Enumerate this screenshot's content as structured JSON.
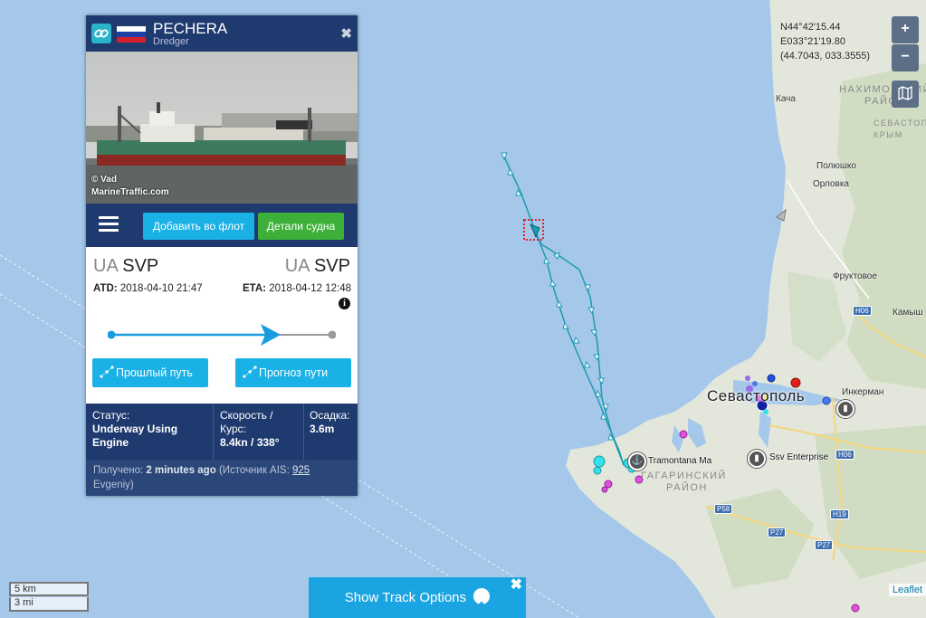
{
  "vessel": {
    "name": "PECHERA",
    "type": "Dredger",
    "photo_credit": "© Vad",
    "photo_site": "MarineTraffic.com",
    "buttons": {
      "add_fleet": "Добавить во флот",
      "details": "Детали судна"
    },
    "departure": {
      "country": "UA",
      "port": "SVP",
      "label": "ATD:",
      "time": "2018-04-10 21:47"
    },
    "arrival": {
      "country": "UA",
      "port": "SVP",
      "label": "ETA:",
      "time": "2018-04-12 12:48"
    },
    "progress_fraction": 0.75,
    "route_buttons": {
      "past": "Прошлый путь",
      "forecast": "Прогноз пути"
    },
    "status": {
      "label": "Статус:",
      "value": "Underway Using Engine"
    },
    "speed": {
      "label": "Скорость / Курс:",
      "value": "8.4kn / 338°"
    },
    "draught": {
      "label": "Осадка:",
      "value": "3.6m"
    },
    "received": {
      "prefix": "Получено:",
      "age": "2 minutes ago",
      "source_prefix": "(Источник AIS:",
      "source_id": "925",
      "source_name": "Evgeniy)"
    }
  },
  "map": {
    "coords": {
      "lat": "N44°42'15.44",
      "lon": "E033°21'19.80",
      "decimal": "(44.7043, 033.3555)"
    },
    "zoom_in": "+",
    "zoom_out": "−",
    "scale_km": "5 km",
    "scale_mi": "3 mi",
    "attribution": "Leaflet",
    "track_options": "Show Track Options",
    "labels": {
      "sevastopol": "Севастополь",
      "nakhimovsky": "НАХИМОВСКИЙ",
      "nakhimovsky2": "РАЙОН",
      "gagarinsky": "ГАГАРИНСКИЙ",
      "gagarinsky2": "РАЙОН",
      "sevastopol_region": "СЕВАСТОПО",
      "crimea": "КРЫМ",
      "kacha": "Кача",
      "polyushko": "Полюшко",
      "orlovka": "Орловка",
      "fruktovoe": "Фруктовое",
      "kamysh": "Камыш",
      "inkerman": "Инкерман",
      "tramontana": "Tramontana Ma",
      "ssv": "Ssv Enterprise"
    },
    "roads": [
      "H06",
      "H06",
      "P58",
      "H19",
      "P27",
      "P27"
    ]
  },
  "colors": {
    "sea": "#a5c8ea",
    "land": "#e3e7dc",
    "track": "#1c9bb2",
    "panel_dark": "#1e3a6e",
    "accent_blue": "#1ab1e6",
    "accent_green": "#3db03a"
  }
}
